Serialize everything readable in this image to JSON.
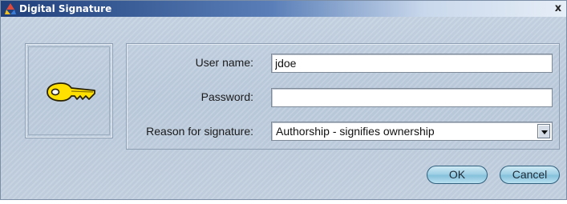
{
  "window": {
    "title": "Digital Signature",
    "close_label": "x"
  },
  "icons": {
    "app": "signature-app-icon",
    "main": "key-icon"
  },
  "form": {
    "username": {
      "label": "User name:",
      "value": "jdoe"
    },
    "password": {
      "label": "Password:",
      "value": ""
    },
    "reason": {
      "label": "Reason for signature:",
      "selected": "Authorship - signifies ownership"
    }
  },
  "buttons": {
    "ok": "OK",
    "cancel": "Cancel"
  },
  "colors": {
    "titlebar_start": "#1f3f7a",
    "dialog_bg": "#c3d0df",
    "button_fill": "#9fd0e6",
    "key_yellow": "#ffe000"
  }
}
